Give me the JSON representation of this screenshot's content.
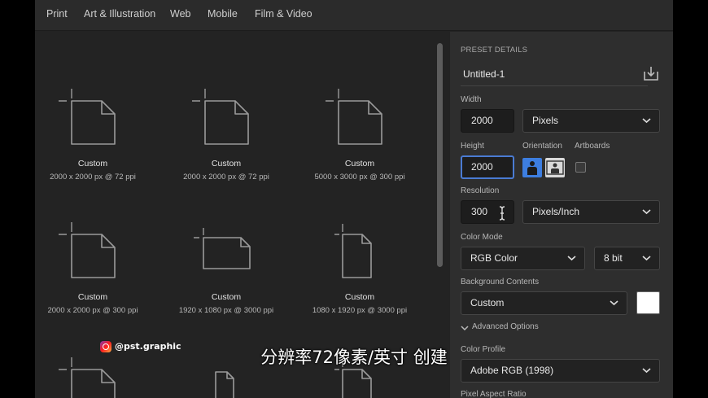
{
  "tabs": [
    "Print",
    "Art & Illustration",
    "Web",
    "Mobile",
    "Film & Video"
  ],
  "presets": [
    {
      "name": "Custom",
      "spec": "2000 x 2000 px @ 72 ppi"
    },
    {
      "name": "Custom",
      "spec": "2000 x 2000 px @ 72 ppi"
    },
    {
      "name": "Custom",
      "spec": "5000 x 3000 px @ 300 ppi"
    },
    {
      "name": "Custom",
      "spec": "2000 x 2000 px @ 300 ppi"
    },
    {
      "name": "Custom",
      "spec": "1920 x 1080 px @ 3000 ppi"
    },
    {
      "name": "Custom",
      "spec": "1080 x 1920 px @ 3000 ppi"
    }
  ],
  "panel": {
    "section_title": "PRESET DETAILS",
    "doc_name": "Untitled-1",
    "width_label": "Width",
    "width_value": "2000",
    "width_unit": "Pixels",
    "height_label": "Height",
    "height_value": "2000",
    "orientation_label": "Orientation",
    "artboards_label": "Artboards",
    "resolution_label": "Resolution",
    "resolution_value": "300",
    "resolution_unit": "Pixels/Inch",
    "color_mode_label": "Color Mode",
    "color_mode_value": "RGB Color",
    "bit_depth_value": "8 bit",
    "bg_contents_label": "Background Contents",
    "bg_contents_value": "Custom",
    "bg_color": "#ffffff",
    "advanced_label": "Advanced Options",
    "color_profile_label": "Color Profile",
    "color_profile_value": "Adobe RGB (1998)",
    "pixel_aspect_label": "Pixel Aspect Ratio"
  },
  "watermark": "@pst.graphic",
  "subtitle": "分辨率72像素/英寸 创建",
  "colors": {
    "accent": "#4a7bd3",
    "panel_bg": "#2e2e2e",
    "grid_bg": "#232323"
  }
}
